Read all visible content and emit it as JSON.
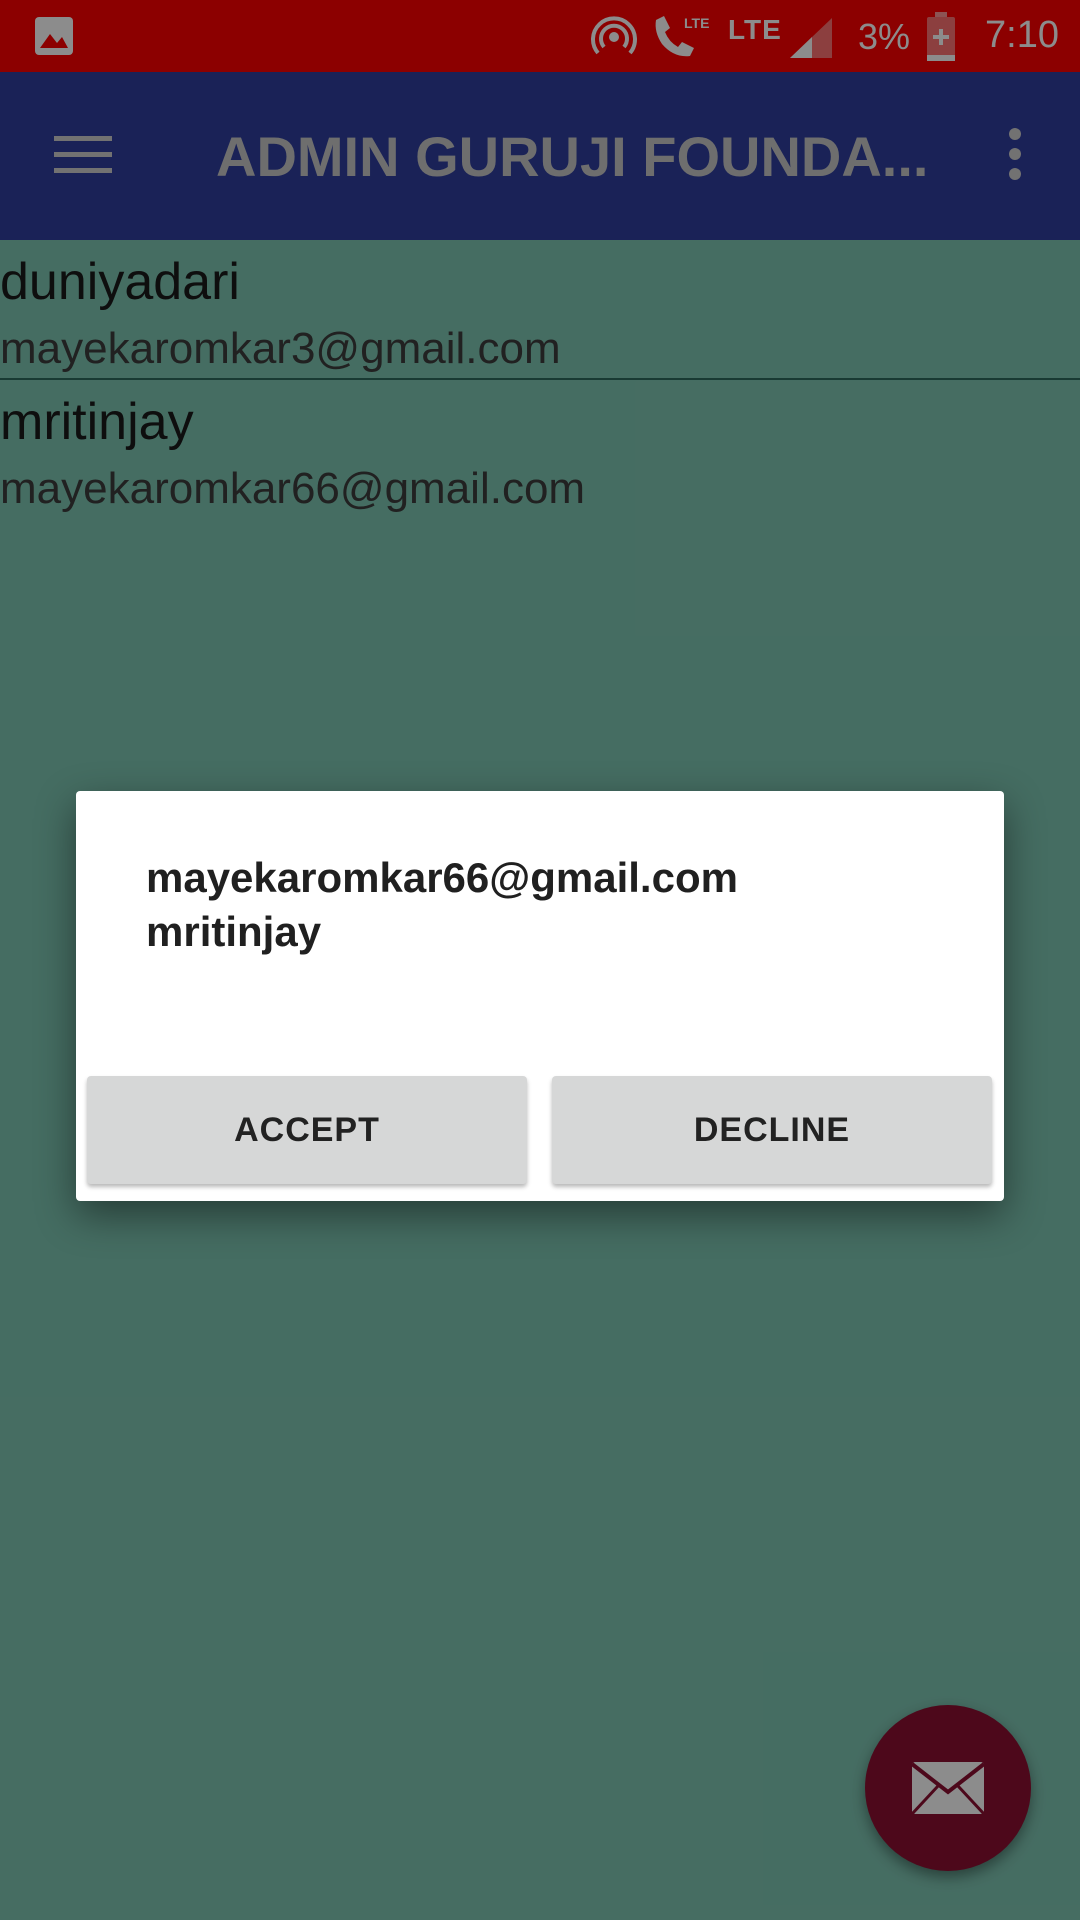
{
  "status_bar": {
    "network_label": "LTE",
    "battery_percent": "3%",
    "time": "7:10",
    "call_badge": "LTE"
  },
  "app_bar": {
    "title": "ADMIN GURUJI FOUNDA..."
  },
  "list": {
    "items": [
      {
        "name": "duniyadari",
        "email": "mayekaromkar3@gmail.com"
      },
      {
        "name": "mritinjay",
        "email": "mayekaromkar66@gmail.com"
      }
    ]
  },
  "dialog": {
    "line1": "mayekaromkar66@gmail.com",
    "line2": "mritinjay",
    "accept_label": "ACCEPT",
    "decline_label": "DECLINE"
  },
  "colors": {
    "status_bar": "#ff0000",
    "app_bar": "#303f9f",
    "background": "#7fc6b3",
    "fab": "#8c0f32"
  },
  "icons": {
    "status_left": "gallery-icon",
    "fab": "mail-icon",
    "nav": "menu-icon",
    "overflow": "overflow-icon"
  }
}
